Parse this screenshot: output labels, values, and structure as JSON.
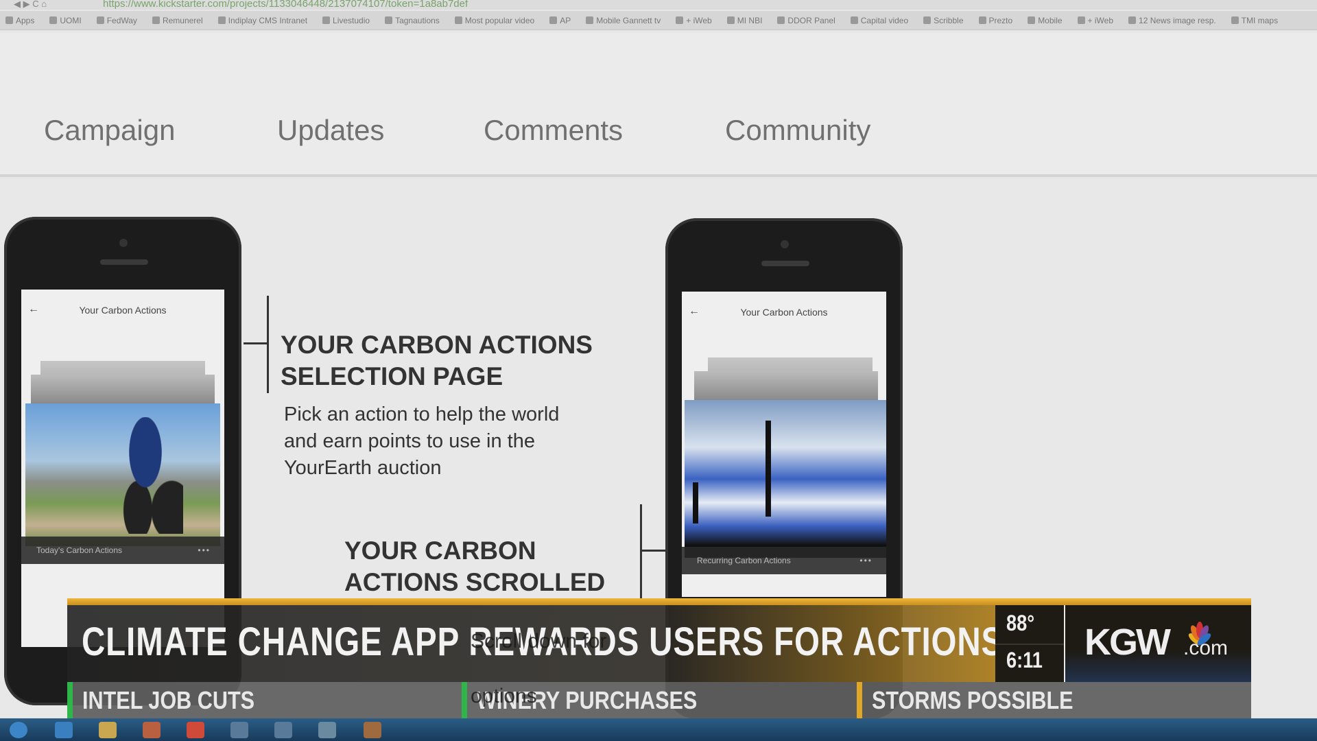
{
  "browser": {
    "url": "https://www.kickstarter.com/projects/1133046448/2137074107/token=1a8ab7def",
    "bookmarks": [
      "Apps",
      "UOMI",
      "FedWay",
      "Remunerel",
      "Indiplay CMS Intranet",
      "Livestudio",
      "Tagnautions",
      "Most popular video",
      "AP",
      "Mobile Gannett tv",
      "+ iWeb",
      "MI NBI",
      "DDOR Panel",
      "Capital video",
      "Scribble",
      "Prezto",
      "Mobile",
      "+ iWeb",
      "12 News image resp.",
      "TMI maps"
    ]
  },
  "tabs": [
    "Campaign",
    "Updates",
    "Comments",
    "Community"
  ],
  "phone1": {
    "title": "Your Carbon Actions",
    "caption": "Today's Carbon Actions",
    "more": "•••"
  },
  "phone2": {
    "title": "Your Carbon Actions",
    "caption": "Recurring Carbon Actions",
    "more": "•••"
  },
  "section1": {
    "heading_line1": "YOUR CARBON ACTIONS",
    "heading_line2": "SELECTION PAGE",
    "body_lines": [
      "Pick an action to help the world",
      "and earn points to use in the",
      "YourEarth auction"
    ]
  },
  "section2": {
    "heading_line1": "YOUR CARBON",
    "heading_line2": "ACTIONS SCROLLED",
    "body_lines": [
      "Scroll down for",
      "options"
    ]
  },
  "lower_third": {
    "headline": "CLIMATE CHANGE APP REWARDS USERS FOR ACTIONS",
    "temperature": "88°",
    "time": "6:11",
    "logo": "KGW.com",
    "ticker": [
      {
        "text": "INTEL JOB CUTS",
        "color": "#2fb54a"
      },
      {
        "text": "WINERY PURCHASES",
        "color": "#2fb54a"
      },
      {
        "text": "STORMS POSSIBLE",
        "color": "#e0a726"
      }
    ]
  },
  "colors": {
    "accent_gold": "#e0a726",
    "taskbar": "#1f4a70"
  }
}
